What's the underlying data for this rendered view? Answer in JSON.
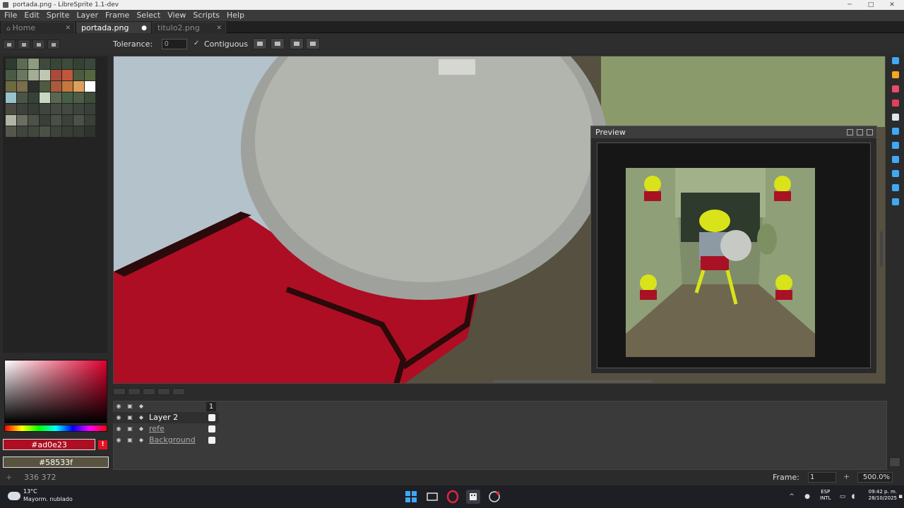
{
  "window": {
    "title": "portada.png - LibreSprite 1.1-dev",
    "minimize": "─",
    "maximize": "□",
    "close": "✕"
  },
  "menu": [
    "File",
    "Edit",
    "Sprite",
    "Layer",
    "Frame",
    "Select",
    "View",
    "Scripts",
    "Help"
  ],
  "tabs": [
    {
      "label": "Home",
      "close": "✕"
    },
    {
      "label": "portada.png",
      "close": "●"
    },
    {
      "label": "titulo2.png",
      "close": "✕"
    }
  ],
  "toolbar": {
    "tolerance_label": "Tolerance:",
    "tolerance_value": "0",
    "contiguous_check": "✓",
    "contiguous_label": "Contiguous"
  },
  "palette": {
    "colors": [
      "#2f3a30",
      "#5d6b55",
      "#8f9a7e",
      "#3d4a3c",
      "#3a4634",
      "#3e4b3a",
      "#354232",
      "#3a473a",
      "#4b5a45",
      "#6a7860",
      "#a3ad95",
      "#bfc6b2",
      "#aa4a3a",
      "#c2563c",
      "#4b5b40",
      "#56673f",
      "#6d6a3f",
      "#7a6e4b",
      "#2c2f2c",
      "#4f5a40",
      "#a85a3c",
      "#c4783c",
      "#dba05c",
      "#ffffff",
      "#98c2cc",
      "#495647",
      "#384238",
      "#c8d8c0",
      "#5b6652",
      "#466048",
      "#4e5e46",
      "#3f4c3a",
      "#4a4a40",
      "#3b423a",
      "#373d36",
      "#3f463d",
      "#434a40",
      "#424a41",
      "#3d453c",
      "#394038",
      "#b0b6a6",
      "#6a6e60",
      "#4d5247",
      "#3a3f38",
      "#4a5045",
      "#3c4237",
      "#4a5147",
      "#3a4036",
      "#54574c",
      "#40463c",
      "#41473e",
      "#4c5146",
      "#3d433a",
      "#383e36",
      "#363c34",
      "#2f332d"
    ]
  },
  "colors": {
    "foreground": "#ad0e23",
    "background": "#58533f",
    "warning": "!"
  },
  "preview": {
    "title": "Preview"
  },
  "tools": [
    {
      "name": "marquee-tool-icon",
      "color": "#3fa9f5"
    },
    {
      "name": "pencil-tool-icon",
      "color": "#f5a623"
    },
    {
      "name": "eraser-tool-icon",
      "color": "#e74c6c"
    },
    {
      "name": "eyedropper-tool-icon",
      "color": "#e0405c"
    },
    {
      "name": "zoom-tool-icon",
      "color": "#dfe6ee"
    },
    {
      "name": "move-tool-icon",
      "color": "#3fa9f5"
    },
    {
      "name": "paint-bucket-tool-icon",
      "color": "#3fa9f5"
    },
    {
      "name": "line-tool-icon",
      "color": "#3fa9f5"
    },
    {
      "name": "ellipse-tool-icon",
      "color": "#3fa9f5"
    },
    {
      "name": "contour-tool-icon",
      "color": "#3fa9f5"
    },
    {
      "name": "blur-tool-icon",
      "color": "#3fa9f5"
    }
  ],
  "timeline": {
    "frame_header": "1",
    "layers": [
      {
        "name": "Layer 2"
      },
      {
        "name": "refe"
      },
      {
        "name": "Background"
      }
    ]
  },
  "status": {
    "coords": "336 372",
    "frame_label": "Frame:",
    "frame_value": "1",
    "zoom": "500.0%"
  },
  "taskbar": {
    "temperature": "13°C",
    "weather": "Mayorm. nublado",
    "lang_line1": "ESP",
    "lang_line2": "INTL",
    "time": "09:42 p. m.",
    "date": "28/10/2025"
  }
}
